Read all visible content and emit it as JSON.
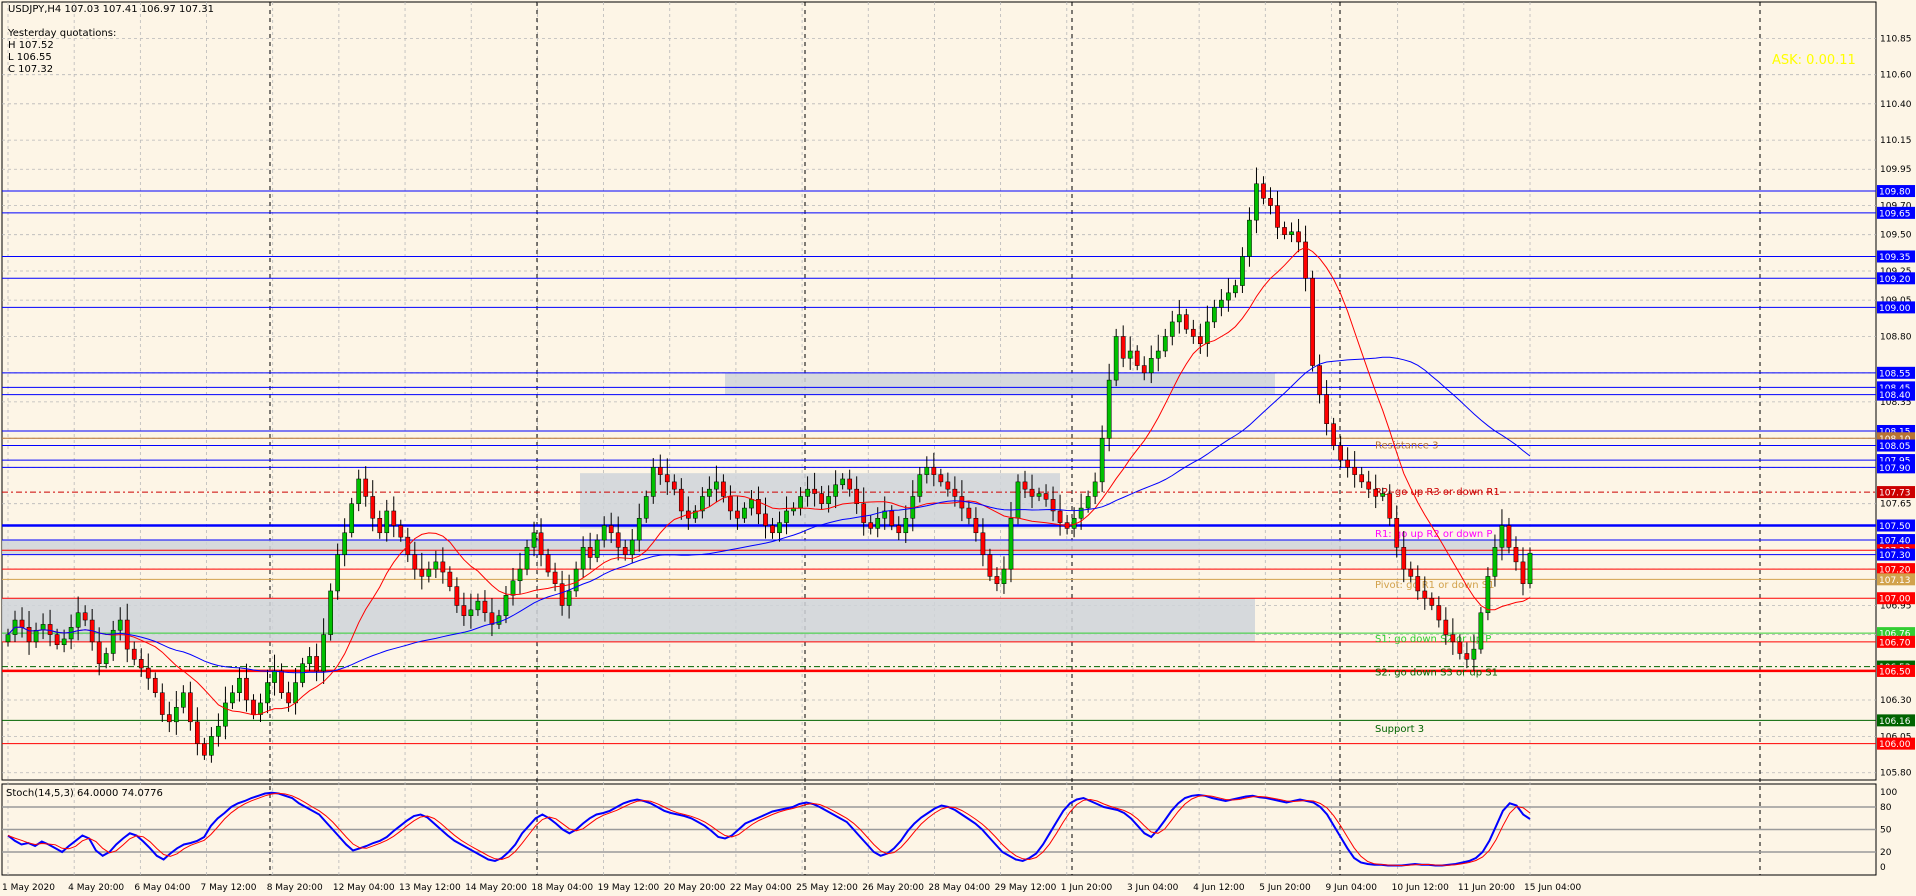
{
  "header": {
    "title": "USDJPY,H4  107.03 107.41 106.97 107.31",
    "lines": [
      "Yesterday quotations:",
      "H 107.52",
      "L 106.55",
      "C 107.32"
    ]
  },
  "ask_label": "ASK: 0.00.11",
  "indicator_label": "Stoch(14,5,3) 64.0000 74.0776",
  "colors": {
    "background": "#fdf5e6",
    "bull": "#00c000",
    "bear": "#ff0000",
    "ma_fast": "#ff0000",
    "ma_slow": "#0000ff",
    "level_blue": "#0000ff",
    "zone": "#cfd3d9"
  },
  "chart_data": [
    {
      "type": "candlestick",
      "symbol": "USDJPY",
      "timeframe": "H4",
      "ylim": [
        105.75,
        111.1
      ],
      "y_ticks": [
        110.85,
        110.6,
        110.4,
        110.15,
        109.95,
        109.7,
        109.5,
        109.25,
        109.05,
        108.8,
        108.55,
        108.35,
        108.1,
        107.9,
        107.65,
        107.4,
        107.2,
        106.95,
        106.75,
        106.5,
        106.3,
        106.05,
        105.8
      ],
      "y_tick_labels": [
        "110.85",
        "110.60",
        "110.40",
        "110.15",
        "109.95",
        "109.70",
        "109.50",
        "109.25",
        "109.05",
        "108.80",
        "108.55",
        "108.35",
        "108.10",
        "107.90",
        "107.65",
        "107.40",
        "107.20",
        "106.95",
        "106.75",
        "106.50",
        "106.30",
        "106.05",
        "105.80"
      ],
      "x_tick_labels": [
        "1 May 2020",
        "4 May 20:00",
        "6 May 04:00",
        "7 May 12:00",
        "8 May 20:00",
        "12 May 04:00",
        "13 May 12:00",
        "14 May 20:00",
        "18 May 04:00",
        "19 May 12:00",
        "20 May 20:00",
        "22 May 04:00",
        "25 May 12:00",
        "26 May 20:00",
        "28 May 04:00",
        "29 May 12:00",
        "1 Jun 20:00",
        "3 Jun 04:00",
        "4 Jun 12:00",
        "5 Jun 20:00",
        "9 Jun 04:00",
        "10 Jun 12:00",
        "11 Jun 20:00",
        "15 Jun 04:00"
      ],
      "closes": [
        106.75,
        106.85,
        106.8,
        106.7,
        106.78,
        106.82,
        106.75,
        106.68,
        106.72,
        106.8,
        106.9,
        106.85,
        106.7,
        106.55,
        106.62,
        106.78,
        106.85,
        106.65,
        106.58,
        106.52,
        106.45,
        106.35,
        106.2,
        106.15,
        106.25,
        106.35,
        106.15,
        106.0,
        105.92,
        106.05,
        106.12,
        106.28,
        106.35,
        106.45,
        106.3,
        106.2,
        106.28,
        106.42,
        106.5,
        106.35,
        106.28,
        106.42,
        106.55,
        106.6,
        106.5,
        106.75,
        107.05,
        107.3,
        107.45,
        107.65,
        107.82,
        107.7,
        107.55,
        107.45,
        107.6,
        107.5,
        107.42,
        107.3,
        107.2,
        107.15,
        107.2,
        107.25,
        107.18,
        107.08,
        106.95,
        106.88,
        106.92,
        106.98,
        106.9,
        106.82,
        106.88,
        107.02,
        107.12,
        107.2,
        107.35,
        107.45,
        107.3,
        107.18,
        107.1,
        106.95,
        107.05,
        107.2,
        107.35,
        107.28,
        107.4,
        107.5,
        107.45,
        107.35,
        107.3,
        107.4,
        107.55,
        107.7,
        107.9,
        107.85,
        107.8,
        107.75,
        107.6,
        107.55,
        107.6,
        107.7,
        107.75,
        107.8,
        107.7,
        107.6,
        107.55,
        107.62,
        107.68,
        107.58,
        107.5,
        107.45,
        107.52,
        107.6,
        107.62,
        107.7,
        107.75,
        107.72,
        107.65,
        107.7,
        107.78,
        107.82,
        107.75,
        107.65,
        107.52,
        107.48,
        107.55,
        107.6,
        107.5,
        107.45,
        107.55,
        107.7,
        107.85,
        107.9,
        107.85,
        107.8,
        107.75,
        107.7,
        107.62,
        107.55,
        107.45,
        107.3,
        107.15,
        107.1,
        107.2,
        107.55,
        107.8,
        107.75,
        107.7,
        107.72,
        107.68,
        107.6,
        107.52,
        107.48,
        107.55,
        107.62,
        107.7,
        107.8,
        108.1,
        108.5,
        108.8,
        108.65,
        108.7,
        108.6,
        108.55,
        108.65,
        108.7,
        108.8,
        108.9,
        108.95,
        108.85,
        108.8,
        108.75,
        108.9,
        109.0,
        109.05,
        109.1,
        109.15,
        109.35,
        109.6,
        109.85,
        109.75,
        109.7,
        109.55,
        109.5,
        109.52,
        109.45,
        109.2,
        108.6,
        108.4,
        108.2,
        108.05,
        107.95,
        107.9,
        107.85,
        107.8,
        107.75,
        107.7,
        107.72,
        107.55,
        107.35,
        107.2,
        107.15,
        107.05,
        107.0,
        106.95,
        106.85,
        106.75,
        106.7,
        106.62,
        106.58,
        106.65,
        106.9,
        107.15,
        107.35,
        107.5,
        107.35,
        107.25,
        107.1,
        107.31
      ],
      "series": [
        {
          "name": "MA fast",
          "color": "#ff0000"
        },
        {
          "name": "MA slow",
          "color": "#0000ff"
        }
      ],
      "levels": [
        {
          "price": 109.8,
          "label": "109.80",
          "color": "#0000ff",
          "style": "solid"
        },
        {
          "price": 109.65,
          "label": "109.65",
          "color": "#0000ff",
          "style": "solid"
        },
        {
          "price": 109.35,
          "label": "109.35",
          "color": "#0000ff",
          "style": "solid"
        },
        {
          "price": 109.2,
          "label": "109.20",
          "color": "#0000ff",
          "style": "solid"
        },
        {
          "price": 109.0,
          "label": "109.00",
          "color": "#0000ff",
          "style": "solid"
        },
        {
          "price": 108.55,
          "label": "108.55",
          "color": "#0000ff",
          "style": "solid"
        },
        {
          "price": 108.45,
          "label": "108.45",
          "color": "#0000ff",
          "style": "solid"
        },
        {
          "price": 108.4,
          "label": "108.40",
          "color": "#0000ff",
          "style": "solid"
        },
        {
          "price": 108.15,
          "label": "108.15",
          "color": "#0000ff",
          "style": "solid"
        },
        {
          "price": 108.1,
          "label": "108.10",
          "color": "#b87333",
          "style": "solid"
        },
        {
          "price": 108.05,
          "label": "108.05",
          "color": "#0000ff",
          "style": "solid"
        },
        {
          "price": 107.95,
          "label": "107.95",
          "color": "#0000ff",
          "style": "solid"
        },
        {
          "price": 107.9,
          "label": "107.90",
          "color": "#0000ff",
          "style": "solid"
        },
        {
          "price": 107.73,
          "label": "107.73",
          "color": "#cc0000",
          "style": "dash"
        },
        {
          "price": 107.5,
          "label": "107.50",
          "color": "#0000ff",
          "style": "thick"
        },
        {
          "price": 107.4,
          "label": "107.40",
          "color": "#0000ff",
          "style": "solid"
        },
        {
          "price": 107.33,
          "label": "107.33",
          "color": "#ff0000",
          "style": "solid"
        },
        {
          "price": 107.3,
          "label": "107.30",
          "color": "#0000ff",
          "style": "solid"
        },
        {
          "price": 107.2,
          "label": "107.20",
          "color": "#ff0000",
          "style": "solid"
        },
        {
          "price": 107.13,
          "label": "107.13",
          "color": "#d2a24c",
          "style": "solid"
        },
        {
          "price": 107.0,
          "label": "107.00",
          "color": "#ff0000",
          "style": "solid"
        },
        {
          "price": 106.76,
          "label": "106.76",
          "color": "#32cd32",
          "style": "solid"
        },
        {
          "price": 106.7,
          "label": "106.70",
          "color": "#ff0000",
          "style": "solid"
        },
        {
          "price": 106.53,
          "label": "106.53",
          "color": "#006400",
          "style": "dash"
        },
        {
          "price": 106.5,
          "label": "106.50",
          "color": "#ff0000",
          "style": "thick"
        },
        {
          "price": 106.16,
          "label": "106.16",
          "color": "#006400",
          "style": "solid"
        },
        {
          "price": 106.0,
          "label": "106.00",
          "color": "#ff0000",
          "style": "solid"
        }
      ],
      "annotations": [
        {
          "text": "Resistance 3",
          "price": 108.05,
          "color": "#b87333"
        },
        {
          "text": "R2: go up R3 or down R1",
          "price": 107.73,
          "color": "#cc0000"
        },
        {
          "text": "R1: go up R2 or down P",
          "price": 107.44,
          "color": "#ff00ff"
        },
        {
          "text": "Pivot: go R1 or down S1",
          "price": 107.09,
          "color": "#d2a24c"
        },
        {
          "text": "S1: go down S2 or up P",
          "price": 106.72,
          "color": "#32cd32"
        },
        {
          "text": "S2: go down S3 or up S1",
          "price": 106.49,
          "color": "#006400"
        },
        {
          "text": "Support 3",
          "price": 106.1,
          "color": "#006400"
        }
      ],
      "zones": [
        {
          "top": 108.55,
          "bottom": 108.4
        },
        {
          "top": 107.86,
          "bottom": 107.48
        },
        {
          "top": 107.4,
          "bottom": 107.3
        },
        {
          "top": 107.0,
          "bottom": 106.7
        }
      ]
    },
    {
      "type": "line",
      "indicator": "Stochastic",
      "ylim": [
        0,
        100
      ],
      "y_tick_labels": [
        "100",
        "80",
        "50",
        "20",
        "0"
      ],
      "levels": [
        80,
        50,
        20
      ],
      "series": [
        {
          "name": "%K",
          "color": "#0000ff",
          "values": [
            42,
            35,
            30,
            32,
            28,
            34,
            30,
            25,
            20,
            28,
            35,
            42,
            38,
            22,
            15,
            20,
            30,
            38,
            45,
            42,
            34,
            25,
            15,
            10,
            18,
            25,
            30,
            32,
            35,
            40,
            55,
            65,
            72,
            80,
            85,
            88,
            92,
            95,
            98,
            99,
            98,
            95,
            92,
            85,
            80,
            75,
            70,
            60,
            50,
            40,
            30,
            22,
            25,
            28,
            32,
            35,
            40,
            48,
            55,
            62,
            68,
            70,
            66,
            58,
            50,
            42,
            35,
            30,
            25,
            20,
            15,
            10,
            8,
            12,
            20,
            30,
            45,
            55,
            65,
            70,
            65,
            58,
            50,
            45,
            50,
            58,
            65,
            70,
            72,
            75,
            80,
            85,
            88,
            90,
            88,
            85,
            80,
            75,
            72,
            70,
            68,
            65,
            60,
            55,
            48,
            40,
            38,
            42,
            50,
            58,
            62,
            66,
            70,
            74,
            76,
            78,
            80,
            84,
            86,
            84,
            80,
            75,
            70,
            65,
            60,
            50,
            40,
            30,
            20,
            15,
            18,
            25,
            35,
            48,
            58,
            66,
            72,
            78,
            82,
            80,
            76,
            70,
            64,
            58,
            50,
            40,
            30,
            20,
            15,
            10,
            8,
            12,
            18,
            30,
            45,
            60,
            75,
            85,
            90,
            92,
            88,
            84,
            80,
            78,
            76,
            72,
            65,
            55,
            45,
            40,
            50,
            62,
            75,
            85,
            92,
            95,
            96,
            95,
            92,
            90,
            88,
            90,
            92,
            94,
            95,
            93,
            92,
            90,
            88,
            86,
            88,
            90,
            88,
            86,
            80,
            70,
            55,
            40,
            25,
            12,
            6,
            4,
            3,
            3,
            2,
            2,
            2,
            3,
            4,
            3,
            3,
            2,
            2,
            3,
            4,
            6,
            8,
            12,
            20,
            35,
            55,
            75,
            85,
            82,
            70,
            64
          ]
        },
        {
          "name": "%D",
          "color": "#ff0000"
        }
      ]
    }
  ]
}
